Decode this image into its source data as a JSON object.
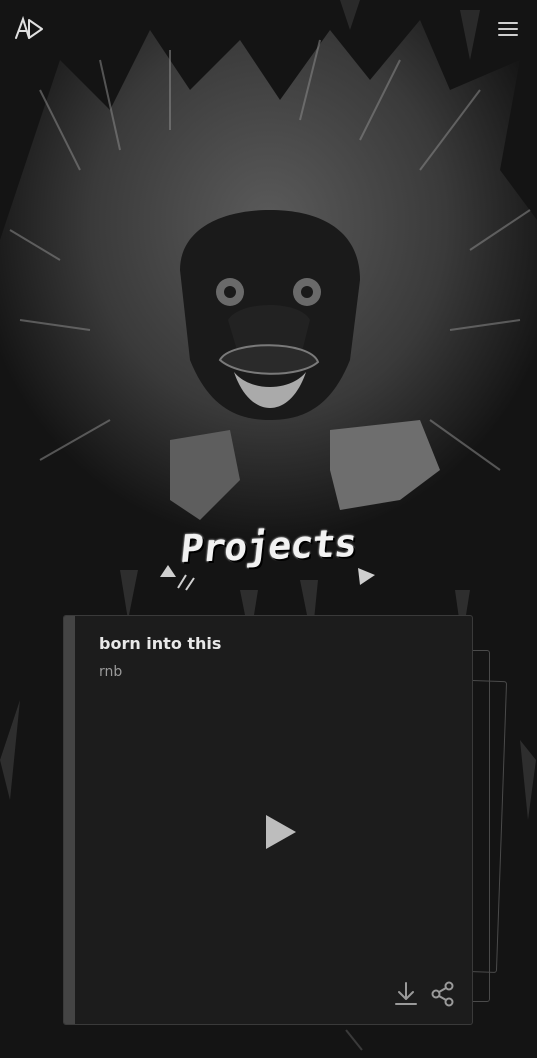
{
  "header": {
    "logo_icon": "ad-monogram-icon",
    "menu_icon": "hamburger-menu-icon"
  },
  "page": {
    "title": "Projects"
  },
  "track": {
    "title": "born into this",
    "genre": "rnb",
    "play_icon": "play-icon",
    "download_icon": "download-icon",
    "share_icon": "share-icon"
  },
  "colors": {
    "background": "#141414",
    "card": "#1c1c1c",
    "accent_text": "#e8e8e8",
    "muted_text": "#9a9a9a"
  }
}
